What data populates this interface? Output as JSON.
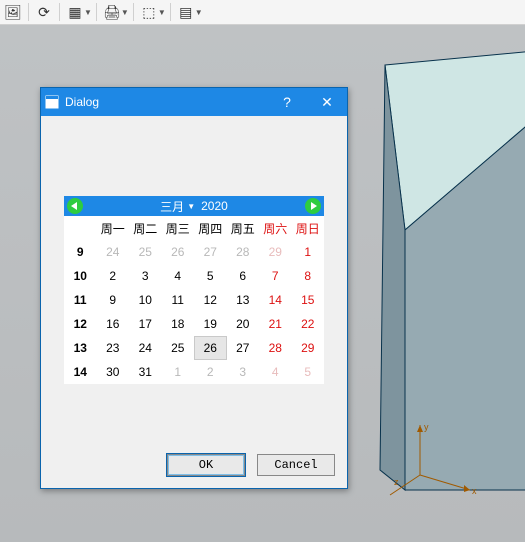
{
  "toolbar": {
    "btn_open_image": "🖼",
    "btn_refresh": "⟳",
    "btn_grid": "▦",
    "btn_print": "🖨",
    "btn_cube": "⬚",
    "btn_layers": "▤"
  },
  "dialog": {
    "title": "Dialog",
    "help": "?",
    "close": "✕",
    "ok": "OK",
    "cancel": "Cancel"
  },
  "calendar": {
    "month": "三月",
    "year": "2020",
    "wk_header": "",
    "dow": [
      "周一",
      "周二",
      "周三",
      "周四",
      "周五",
      "周六",
      "周日"
    ],
    "weeks": [
      {
        "wk": "9",
        "days": [
          {
            "n": "24",
            "other": true
          },
          {
            "n": "25",
            "other": true
          },
          {
            "n": "26",
            "other": true
          },
          {
            "n": "27",
            "other": true
          },
          {
            "n": "28",
            "other": true
          },
          {
            "n": "29",
            "other": true,
            "weekend": true
          },
          {
            "n": "1",
            "weekend": true
          }
        ]
      },
      {
        "wk": "10",
        "days": [
          {
            "n": "2"
          },
          {
            "n": "3"
          },
          {
            "n": "4"
          },
          {
            "n": "5"
          },
          {
            "n": "6"
          },
          {
            "n": "7",
            "weekend": true
          },
          {
            "n": "8",
            "weekend": true
          }
        ]
      },
      {
        "wk": "11",
        "days": [
          {
            "n": "9"
          },
          {
            "n": "10"
          },
          {
            "n": "11"
          },
          {
            "n": "12"
          },
          {
            "n": "13"
          },
          {
            "n": "14",
            "weekend": true
          },
          {
            "n": "15",
            "weekend": true
          }
        ]
      },
      {
        "wk": "12",
        "days": [
          {
            "n": "16"
          },
          {
            "n": "17"
          },
          {
            "n": "18"
          },
          {
            "n": "19"
          },
          {
            "n": "20"
          },
          {
            "n": "21",
            "weekend": true
          },
          {
            "n": "22",
            "weekend": true
          }
        ]
      },
      {
        "wk": "13",
        "days": [
          {
            "n": "23"
          },
          {
            "n": "24"
          },
          {
            "n": "25"
          },
          {
            "n": "26",
            "selected": true
          },
          {
            "n": "27"
          },
          {
            "n": "28",
            "weekend": true
          },
          {
            "n": "29",
            "weekend": true
          }
        ]
      },
      {
        "wk": "14",
        "days": [
          {
            "n": "30"
          },
          {
            "n": "31"
          },
          {
            "n": "1",
            "other": true
          },
          {
            "n": "2",
            "other": true
          },
          {
            "n": "3",
            "other": true
          },
          {
            "n": "4",
            "other": true,
            "weekend": true
          },
          {
            "n": "5",
            "other": true,
            "weekend": true
          }
        ]
      }
    ]
  },
  "axes": {
    "x": "x",
    "y": "y",
    "z": "z"
  }
}
